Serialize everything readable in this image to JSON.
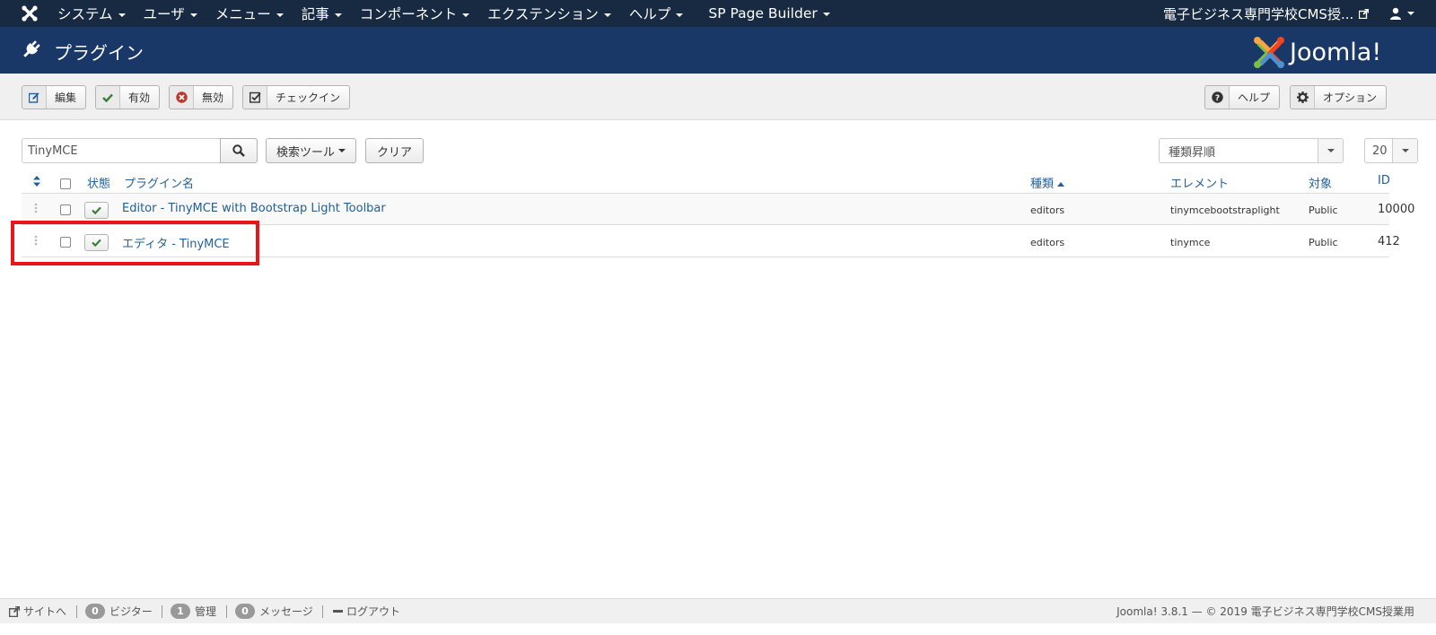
{
  "topnav": {
    "menu": [
      {
        "label": "システム"
      },
      {
        "label": "ユーザ"
      },
      {
        "label": "メニュー"
      },
      {
        "label": "記事"
      },
      {
        "label": "コンポーネント"
      },
      {
        "label": "エクステンション"
      },
      {
        "label": "ヘルプ"
      },
      {
        "label": "SP Page Builder"
      }
    ],
    "site_name": "電子ビジネス専門学校CMS授..."
  },
  "header": {
    "title": "プラグイン",
    "logo_text": "Joomla!"
  },
  "toolbar": {
    "edit": "編集",
    "enable": "有効",
    "disable": "無効",
    "checkin": "チェックイン",
    "help": "ヘルプ",
    "options": "オプション"
  },
  "filters": {
    "search_value": "TinyMCE",
    "search_tools": "検索ツール",
    "clear": "クリア",
    "sort": "種類昇順",
    "limit": "20"
  },
  "table": {
    "headers": {
      "status": "状態",
      "name": "プラグイン名",
      "type": "種類",
      "element": "エレメント",
      "access": "対象",
      "id": "ID"
    },
    "rows": [
      {
        "name": "Editor - TinyMCE with Bootstrap Light Toolbar",
        "type": "editors",
        "element": "tinymcebootstraplight",
        "access": "Public",
        "id": "10000",
        "enabled": true
      },
      {
        "name": "エディタ - TinyMCE",
        "type": "editors",
        "element": "tinymce",
        "access": "Public",
        "id": "412",
        "enabled": true
      }
    ]
  },
  "footer": {
    "site": "サイトへ",
    "visitors_count": "0",
    "visitors": "ビジター",
    "admins_count": "1",
    "admins": "管理",
    "messages_count": "0",
    "messages": "メッセージ",
    "logout": "ログアウト",
    "copyright": "Joomla! 3.8.1 — © 2019 電子ビジネス専門学校CMS授業用"
  },
  "colors": {
    "topnav_bg": "#172a41",
    "header_bg": "#1a3867",
    "link": "#226099",
    "highlight": "#e8151b"
  }
}
